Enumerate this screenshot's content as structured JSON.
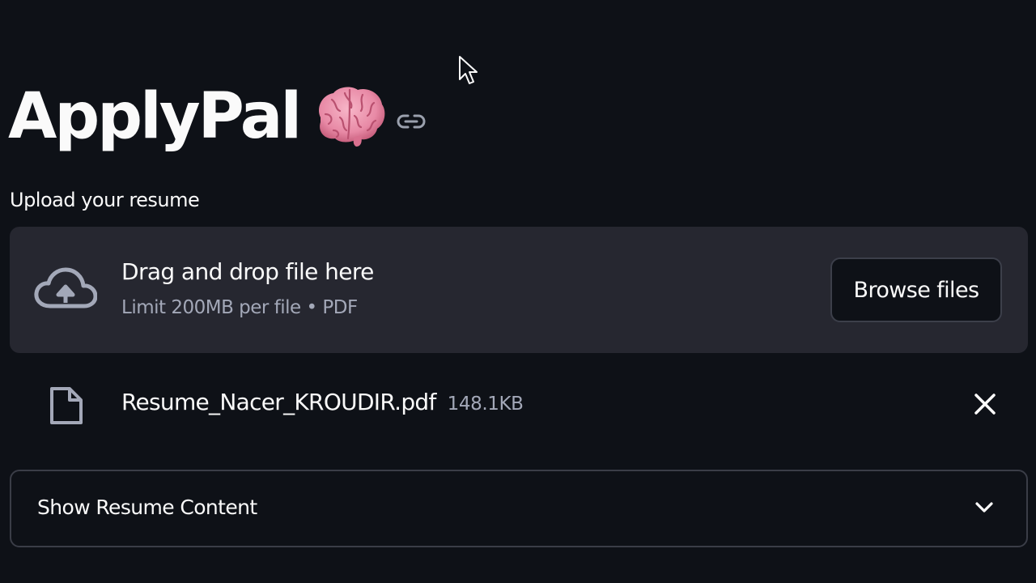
{
  "app": {
    "title": "ApplyPal",
    "title_emoji_icon": "brain-icon",
    "anchor_icon": "link-icon"
  },
  "uploader": {
    "label": "Upload your resume",
    "dropzone_title": "Drag and drop file here",
    "dropzone_limit": "Limit 200MB per file • PDF",
    "browse_label": "Browse files",
    "icon": "upload-cloud-icon"
  },
  "uploaded_file": {
    "name": "Resume_Nacer_KROUDIR.pdf",
    "size": "148.1KB",
    "icon": "file-icon",
    "remove_icon": "close-icon"
  },
  "expander": {
    "label": "Show Resume Content",
    "icon": "chevron-down-icon"
  },
  "colors": {
    "background": "#0e1117",
    "dropzone_bg": "#262730",
    "text": "#fafafa",
    "muted_text": "#a3a8b8",
    "border": "#3a3d47"
  }
}
